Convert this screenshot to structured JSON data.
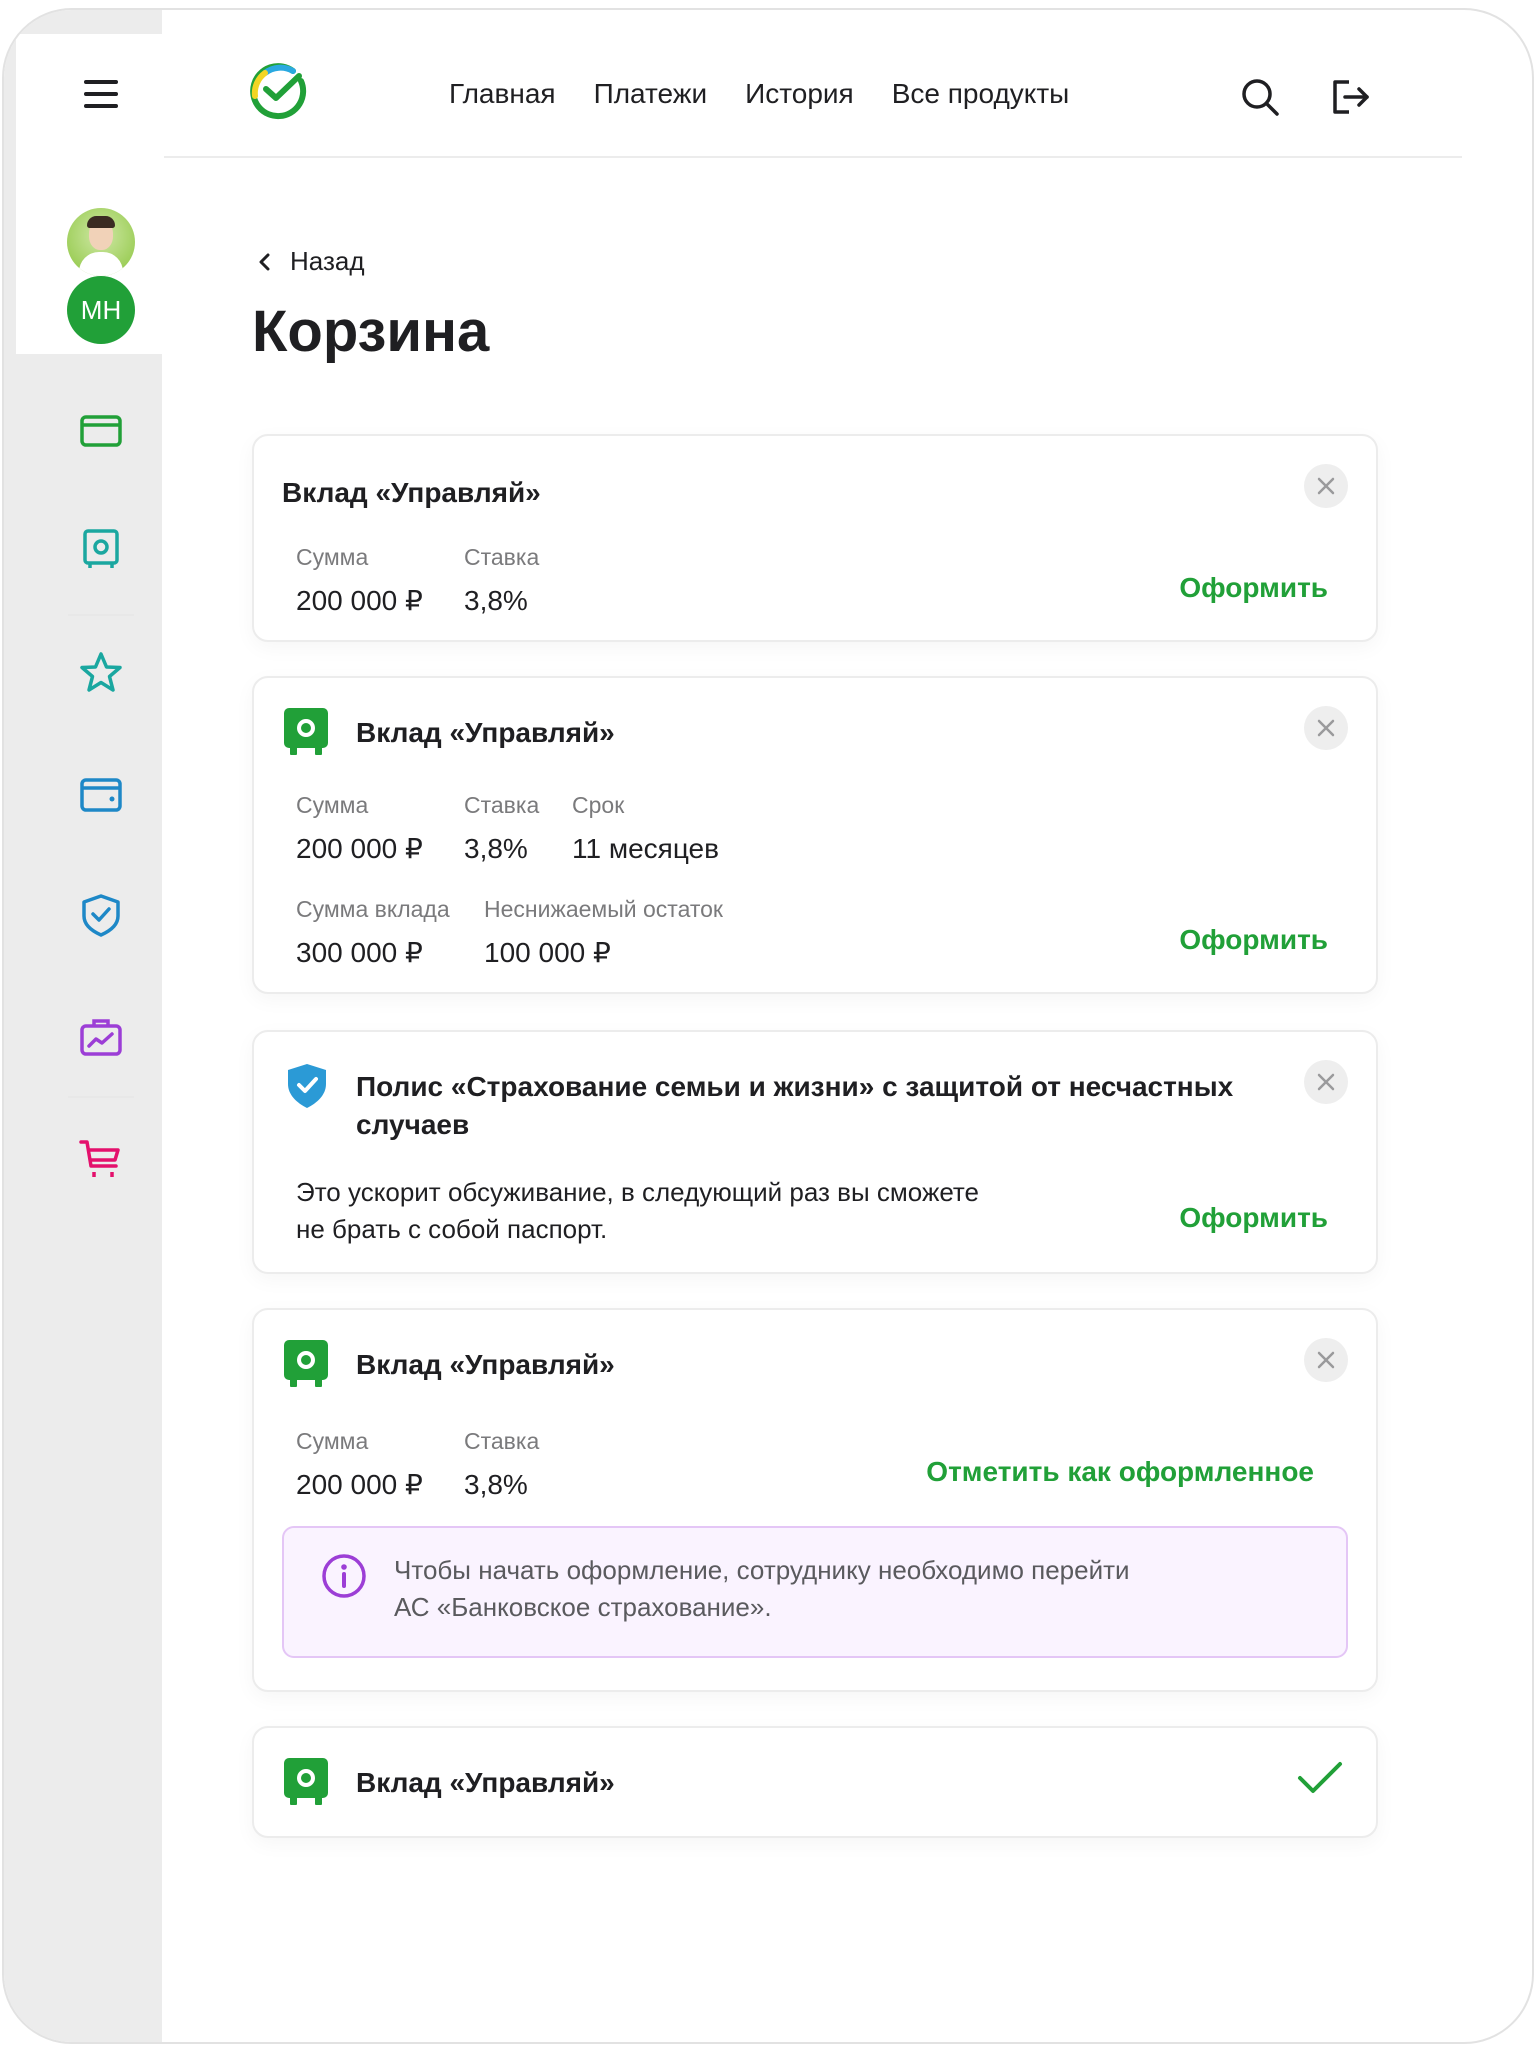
{
  "sidebar": {
    "menu_icon": "hamburger-icon",
    "avatar_initials": "МН",
    "items": [
      {
        "icon": "card-icon",
        "color": "#21a038"
      },
      {
        "icon": "safe-icon",
        "color": "#1aa7a0"
      },
      {
        "icon": "star-icon",
        "color": "#1aa7a0"
      },
      {
        "icon": "wallet-icon",
        "color": "#1e88c7"
      },
      {
        "icon": "shield-icon",
        "color": "#1e88c7"
      },
      {
        "icon": "briefcase-chart-icon",
        "color": "#9c3ed6"
      },
      {
        "icon": "cart-icon",
        "color": "#e4106c"
      }
    ]
  },
  "header": {
    "logo": "sber-logo",
    "nav": [
      "Главная",
      "Платежи",
      "История",
      "Все продукты"
    ],
    "search_icon": "search-icon",
    "logout_icon": "logout-icon"
  },
  "page": {
    "back_label": "Назад",
    "title": "Корзина"
  },
  "cards": [
    {
      "title": "Вклад «Управляй»",
      "fields": [
        {
          "label": "Сумма",
          "value": "200 000 ₽"
        },
        {
          "label": "Ставка",
          "value": "3,8%"
        }
      ],
      "action": "Оформить"
    },
    {
      "icon": "safe-icon",
      "title": "Вклад «Управляй»",
      "fields": [
        {
          "label": "Сумма",
          "value": "200 000 ₽"
        },
        {
          "label": "Ставка",
          "value": "3,8%"
        },
        {
          "label": "Срок",
          "value": "11 месяцев"
        },
        {
          "label": "Сумма вклада",
          "value": "300 000 ₽"
        },
        {
          "label": "Неснижаемый остаток",
          "value": "100 000 ₽"
        }
      ],
      "action": "Оформить"
    },
    {
      "icon": "shield-check-icon",
      "title_line1": "Полис «Страхование семьи и жизни» с защитой от несчастных",
      "title_line2": "случаев",
      "desc_line1": "Это ускорит обсуживание, в следующий раз вы сможете",
      "desc_line2": "не брать с собой паспорт.",
      "action": "Оформить"
    },
    {
      "icon": "safe-icon",
      "title": "Вклад «Управляй»",
      "fields": [
        {
          "label": "Сумма",
          "value": "200 000 ₽"
        },
        {
          "label": "Ставка",
          "value": "3,8%"
        }
      ],
      "action": "Отметить как оформленное",
      "notice_line1": "Чтобы начать оформление, сотруднику необходимо перейти",
      "notice_line2": "АС «Банковское страхование»."
    },
    {
      "icon": "safe-icon",
      "title": "Вклад «Управляй»",
      "status_icon": "check-icon"
    }
  ],
  "colors": {
    "accent": "#21a038",
    "notice_bg": "#faf3ff",
    "notice_border": "#e4c6f6",
    "info": "#9c3ed6"
  }
}
